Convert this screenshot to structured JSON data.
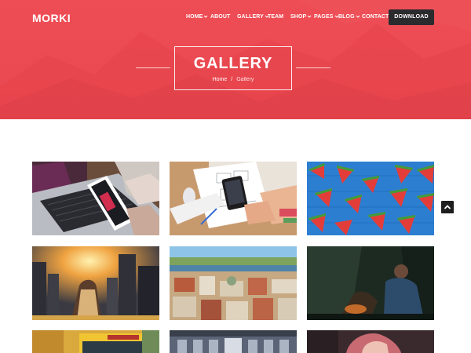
{
  "brand": {
    "logo": "MORKI"
  },
  "nav": {
    "items": [
      {
        "label": "HOME",
        "dropdown": true
      },
      {
        "label": "ABOUT",
        "dropdown": false
      },
      {
        "label": "GALLERY",
        "dropdown": true
      },
      {
        "label": "TEAM",
        "dropdown": false
      },
      {
        "label": "SHOP",
        "dropdown": true
      },
      {
        "label": "PAGES",
        "dropdown": true
      },
      {
        "label": "BLOG",
        "dropdown": true
      },
      {
        "label": "CONTACT",
        "dropdown": false
      }
    ],
    "cta_label": "DOWNLOAD"
  },
  "hero": {
    "title": "GALLERY",
    "breadcrumb": {
      "home": "Home",
      "separator": "/",
      "current": "Gallery"
    }
  },
  "gallery": {
    "items": [
      {
        "name": "laptop-phone-photo"
      },
      {
        "name": "desk-sketch-photo"
      },
      {
        "name": "watermelon-photo"
      },
      {
        "name": "city-skyline-photo"
      },
      {
        "name": "aerial-town-photo"
      },
      {
        "name": "forest-campfire-photo"
      },
      {
        "name": "street-bus-photo"
      },
      {
        "name": "building-interior-photo"
      },
      {
        "name": "portrait-photo"
      }
    ]
  },
  "icons": {
    "dropdown": "chevron-down-icon",
    "back_to_top": "chevron-up-icon"
  },
  "colors": {
    "hero_bg": "#ec4a52",
    "cta_bg": "#2b2b2e",
    "text_light": "#ffffff"
  }
}
